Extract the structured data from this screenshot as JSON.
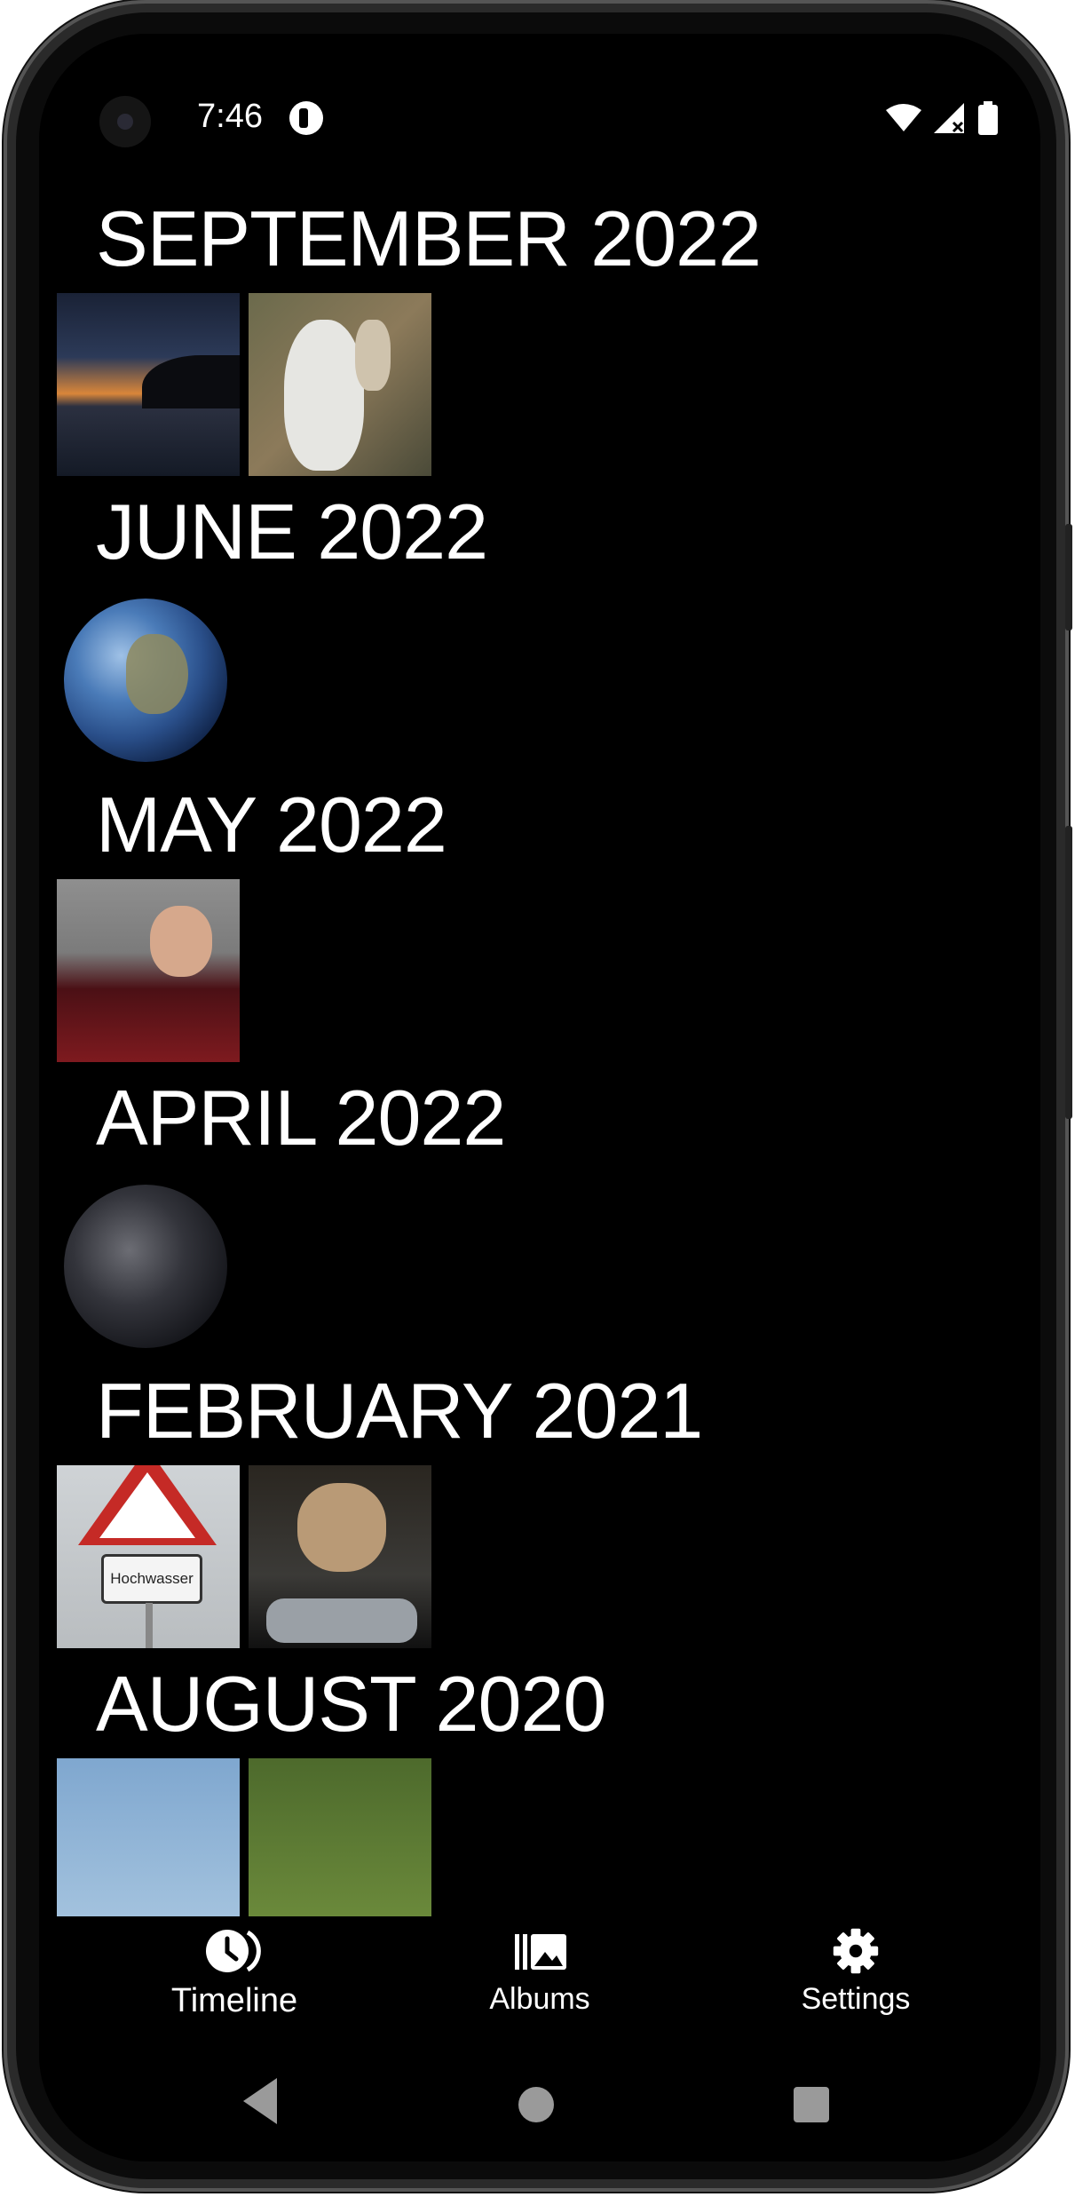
{
  "status_bar": {
    "time": "7:46"
  },
  "timeline": [
    {
      "title": "SEPTEMBER 2022",
      "photos": [
        "sunset-lake",
        "white-cat-statue"
      ]
    },
    {
      "title": "JUNE 2022",
      "photos": [
        "earth-day"
      ]
    },
    {
      "title": "MAY 2022",
      "photos": [
        "picard-facepalm"
      ]
    },
    {
      "title": "APRIL 2022",
      "photos": [
        "earth-night"
      ]
    },
    {
      "title": "FEBRUARY 2021",
      "photos": [
        "hochwasser-sign",
        "cat-motorcycle"
      ]
    },
    {
      "title": "AUGUST 2020",
      "photos": [
        "sky-tree",
        "green-tree"
      ]
    }
  ],
  "sign_text": "Hochwasser",
  "bottom_nav": {
    "timeline_label": "Timeline",
    "albums_label": "Albums",
    "settings_label": "Settings"
  },
  "icons": {
    "timeline": "clock-history-icon",
    "albums": "photo-library-icon",
    "settings": "gear-icon"
  }
}
